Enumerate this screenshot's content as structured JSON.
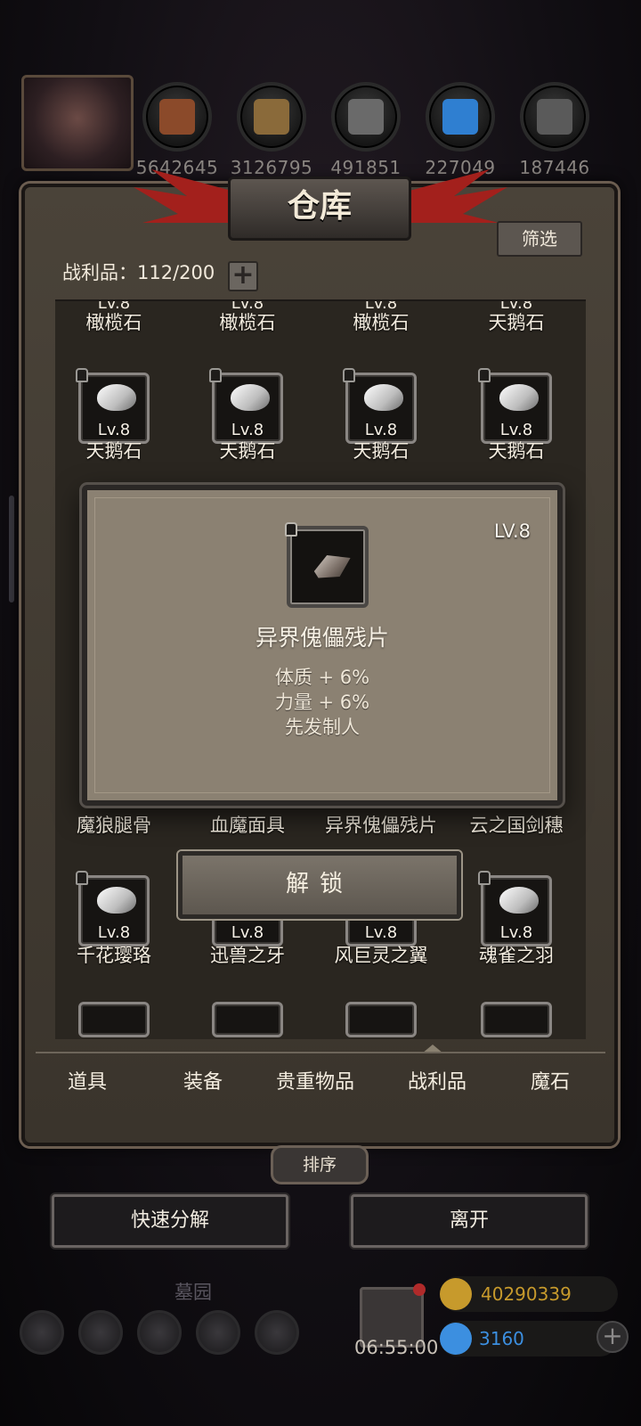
{
  "resources": [
    {
      "name": "wood-resource-icon",
      "value": "5642645",
      "color": "#8b4a2a"
    },
    {
      "name": "plank-resource-icon",
      "value": "3126795",
      "color": "#8a6a3a"
    },
    {
      "name": "stone-resource-icon",
      "value": "491851",
      "color": "#6a6a6a"
    },
    {
      "name": "crystal-resource-icon",
      "value": "227049",
      "color": "#2f7fd1"
    },
    {
      "name": "iron-resource-icon",
      "value": "187446",
      "color": "#5a5a5a"
    }
  ],
  "panel": {
    "title": "仓库",
    "filter_label": "筛选",
    "count_label": "战利品：112/200",
    "plus": "+"
  },
  "partial_row": {
    "level": "Lv.8",
    "names": [
      "橄榄石",
      "橄榄石",
      "橄榄石",
      "天鹅石"
    ]
  },
  "row2": {
    "level": "Lv.8",
    "names": [
      "天鹅石",
      "天鹅石",
      "天鹅石",
      "天鹅石"
    ]
  },
  "row_hidden": {
    "level": "Lv.8",
    "names": [
      "魔狼腿骨",
      "血魔面具",
      "异界傀儡残片",
      "云之国剑穗"
    ]
  },
  "row4": {
    "level": "Lv.8",
    "names": [
      "千花璎珞",
      "迅兽之牙",
      "风巨灵之翼",
      "魂雀之羽"
    ]
  },
  "popup": {
    "level": "LV.8",
    "name": "异界傀儡残片",
    "stats": [
      "体质 + 6%",
      "力量 + 6%",
      "先发制人"
    ]
  },
  "unlock_label": "解锁",
  "tabs": [
    "道具",
    "装备",
    "贵重物品",
    "战利品",
    "魔石"
  ],
  "active_tab": "战利品",
  "sort_label": "排序",
  "quick_decompose_label": "快速分解",
  "leave_label": "离开",
  "bottom": {
    "location": "墓园",
    "timer": "06:55:00",
    "gold": "40290339",
    "gems": "3160",
    "gold_color": "#c79a2c",
    "gem_color": "#3c8fe0"
  }
}
